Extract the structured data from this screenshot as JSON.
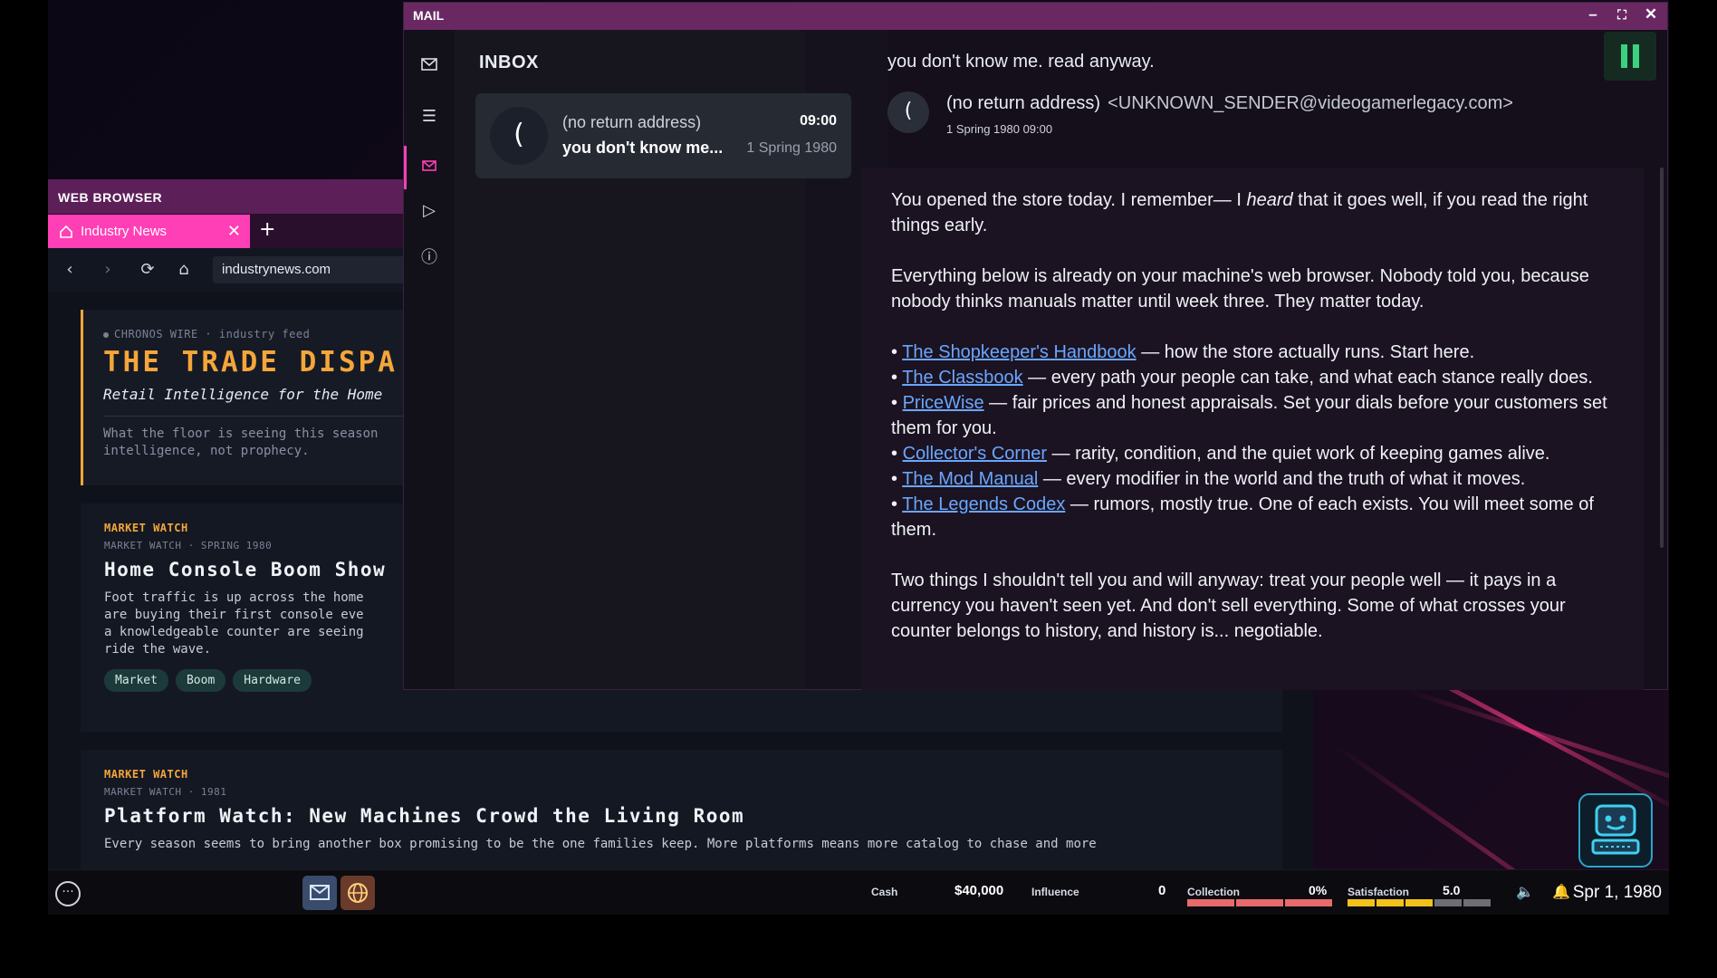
{
  "browser": {
    "title": "WEB BROWSER",
    "tab_label": "Industry News",
    "url": "industrynews.com",
    "hero": {
      "kicker": "CHRONOS WIRE · industry feed",
      "title": "THE TRADE DISPA",
      "subtitle": "Retail Intelligence for the Home",
      "desc_line1": "What the floor is seeing this season",
      "desc_line2": "intelligence, not prophecy."
    },
    "articles": [
      {
        "category": "MARKET WATCH",
        "meta": "MARKET WATCH · SPRING 1980",
        "title": "Home Console Boom Show",
        "body_line1": "Foot traffic is up across the home",
        "body_line2": "are buying their first console eve",
        "body_line3": "a knowledgeable counter are seeing",
        "body_line4": "ride the wave.",
        "tags": [
          "Market",
          "Boom",
          "Hardware"
        ]
      },
      {
        "category": "MARKET WATCH",
        "meta": "MARKET WATCH · 1981",
        "title": "Platform Watch: New Machines Crowd the Living Room",
        "body_line1": "Every season seems to bring another box promising to be the one families keep. More platforms means more catalog to chase and more"
      }
    ]
  },
  "mail": {
    "title": "MAIL",
    "inbox_title": "INBOX",
    "message": {
      "from": "(no return address)",
      "avatar_glyph": "(",
      "time": "09:00",
      "subject_preview": "you don't know me...",
      "date_preview": "1 Spring 1980"
    },
    "reader": {
      "subject": "you don't know me. read anyway.",
      "sender_name": "(no return address)",
      "sender_address": "<UNKNOWN_SENDER@videogamerlegacy.com>",
      "sent": "1 Spring 1980  09:00",
      "p1_a": "You opened the store today. I remember— I ",
      "p1_em": "heard",
      "p1_b": " that it goes well, if you read the right things early.",
      "p2": "Everything below is already on your machine's web browser. Nobody told you, because nobody thinks manuals matter until week three. They matter today.",
      "links": [
        {
          "label": "The Shopkeeper's Handbook",
          "desc": " — how the store actually runs. Start here."
        },
        {
          "label": "The Classbook",
          "desc": " — every path your people can take, and what each stance really does."
        },
        {
          "label": "PriceWise",
          "desc": " — fair prices and honest appraisals. Set your dials before your customers set them for you."
        },
        {
          "label": "Collector's Corner",
          "desc": " — rarity, condition, and the quiet work of keeping games alive."
        },
        {
          "label": "The Mod Manual",
          "desc": " — every modifier in the world and the truth of what it moves."
        },
        {
          "label": "The Legends Codex",
          "desc": " — rumors, mostly true. One of each exists. You will meet some of them."
        }
      ],
      "p3": "Two things I shouldn't tell you and will anyway: treat your people well — it pays in a currency you haven't seen yet. And don't sell everything. Some of what crosses your counter belongs to history, and history is... negotiable."
    }
  },
  "taskbar": {
    "cash_label": "Cash",
    "cash_value": "$40,000",
    "influence_label": "Influence",
    "influence_value": "0",
    "collection_label": "Collection",
    "collection_value": "0%",
    "satisfaction_label": "Satisfaction",
    "satisfaction_value": "5.0",
    "satisfaction_level": 0.6,
    "date": "Spr 1, 1980"
  },
  "colors": {
    "accent": "#ff3fb6",
    "mail_title": "#6a2863",
    "browser_title": "#5c1f58",
    "link": "#6aa6ff",
    "gold": "#f4a63a",
    "pause_green": "#3dd17e",
    "collection_bar": "#e86a6a",
    "satisfaction_bar": "#f2c21b"
  }
}
